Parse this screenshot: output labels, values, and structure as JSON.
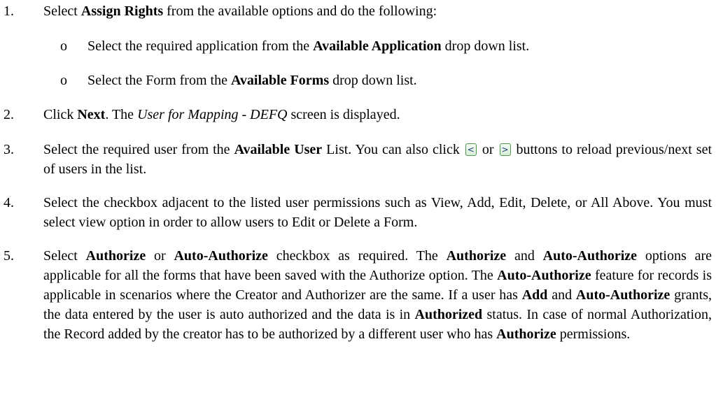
{
  "steps": [
    {
      "num": "1.",
      "parts": [
        {
          "t": "Select "
        },
        {
          "b": "Assign Rights"
        },
        {
          "t": " from the available options and do the following:"
        }
      ],
      "sub": [
        {
          "bullet": "o",
          "parts": [
            {
              "t": "Select the required application from the "
            },
            {
              "b": "Available Application"
            },
            {
              "t": " drop down list."
            }
          ]
        },
        {
          "bullet": "o",
          "parts": [
            {
              "t": "Select the Form from the "
            },
            {
              "b": "Available Forms"
            },
            {
              "t": " drop down list."
            }
          ]
        }
      ]
    },
    {
      "num": "2.",
      "parts": [
        {
          "t": "Click "
        },
        {
          "b": "Next"
        },
        {
          "t": ". The "
        },
        {
          "i": "User for Mapping - DEFQ"
        },
        {
          "t": " screen is displayed."
        }
      ]
    },
    {
      "num": "3.",
      "parts": [
        {
          "t": "Select the required user from the "
        },
        {
          "b": "Available User"
        },
        {
          "t": " List. You can also click "
        },
        {
          "btn": "<",
          "name": "previous-button-icon"
        },
        {
          "t": " or "
        },
        {
          "btn": ">",
          "name": "next-button-icon"
        },
        {
          "t": " buttons to reload previous/next set of users in the list."
        }
      ]
    },
    {
      "num": "4.",
      "parts": [
        {
          "t": "Select the checkbox adjacent to the listed user permissions such as View, Add, Edit, Delete, or All Above. You must select view option in order to allow users to Edit or Delete a Form."
        }
      ]
    },
    {
      "num": "5.",
      "parts": [
        {
          "t": "Select "
        },
        {
          "b": "Authorize"
        },
        {
          "t": " or "
        },
        {
          "b": "Auto-Authorize"
        },
        {
          "t": " checkbox as required. The "
        },
        {
          "b": "Authorize"
        },
        {
          "t": " and "
        },
        {
          "b": "Auto-Authorize"
        },
        {
          "t": " options are applicable for all the forms that have been saved with the Authorize option. The "
        },
        {
          "b": "Auto-Authorize"
        },
        {
          "t": " feature for records is applicable in scenarios where the Creator and Authorizer are the same. If a user has "
        },
        {
          "b": "Add"
        },
        {
          "t": " and "
        },
        {
          "b": "Auto-Authorize"
        },
        {
          "t": " grants, the data entered by the user is auto authorized and the data is in "
        },
        {
          "b": "Authorized"
        },
        {
          "t": " status. In case of normal Authorization, the Record added by the creator has to be authorized by a different user who has "
        },
        {
          "b": "Authorize"
        },
        {
          "t": " permissions."
        }
      ]
    }
  ]
}
